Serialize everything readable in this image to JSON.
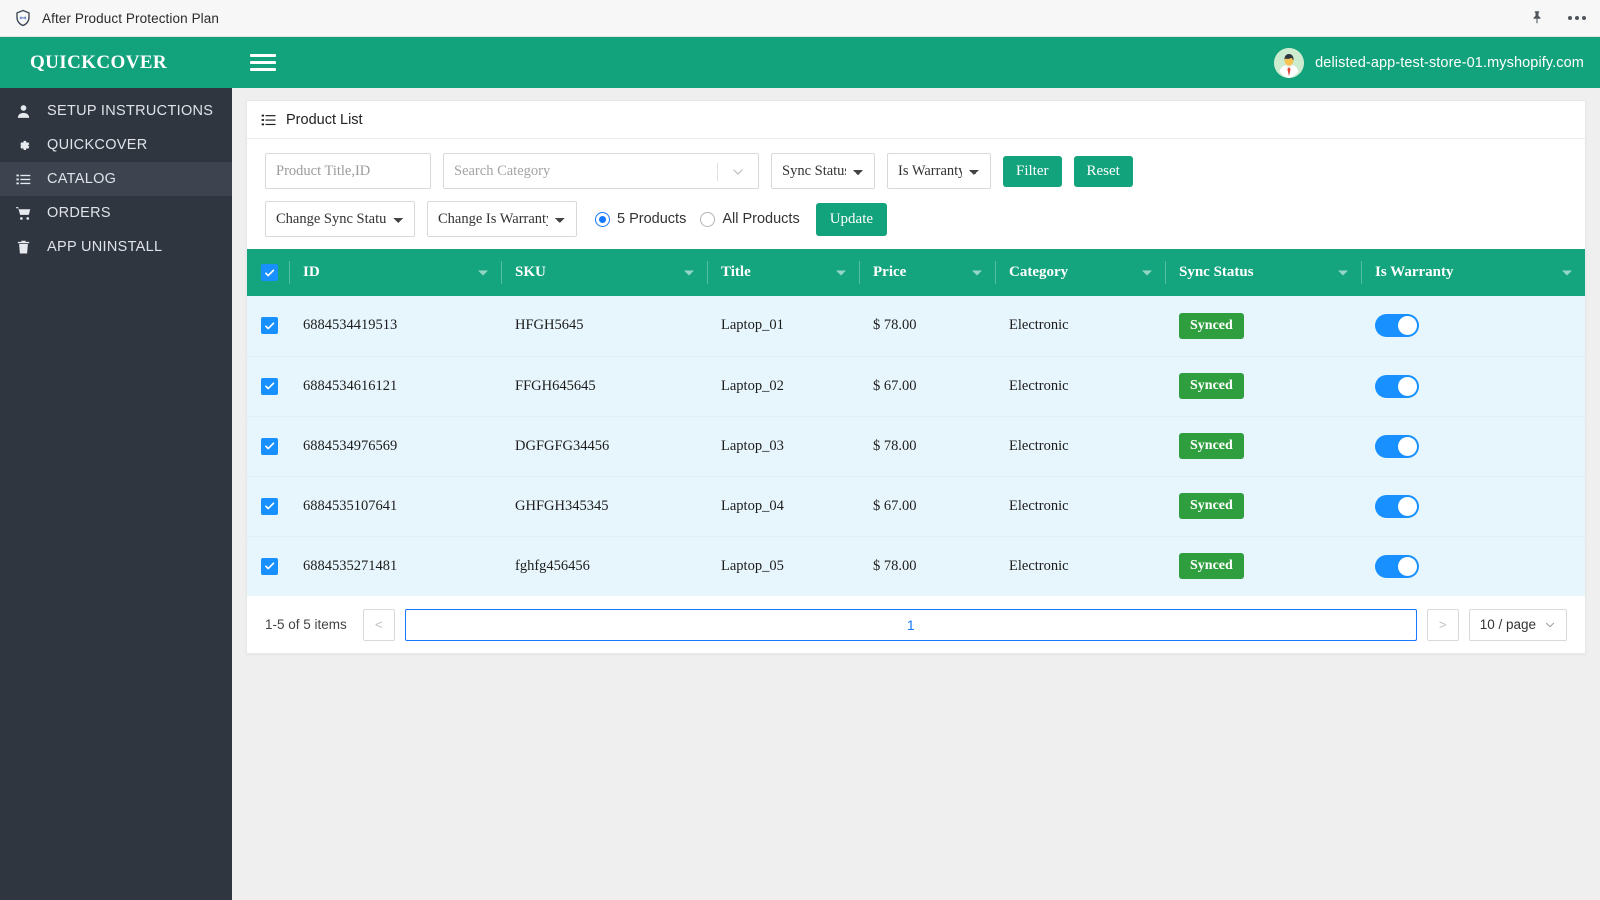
{
  "browser": {
    "title": "After Product Protection Plan",
    "shield_icon": "shield-icon",
    "pin_icon": "pin-icon",
    "more_icon": "more-options-icon"
  },
  "sidebar": {
    "brand": "QUICKCOVER",
    "items": [
      {
        "label": "SETUP INSTRUCTIONS",
        "icon": "user-icon",
        "active": false
      },
      {
        "label": "QUICKCOVER",
        "icon": "gear-icon",
        "active": false
      },
      {
        "label": "CATALOG",
        "icon": "list-icon",
        "active": true
      },
      {
        "label": "ORDERS",
        "icon": "cart-icon",
        "active": false
      },
      {
        "label": "APP UNINSTALL",
        "icon": "trash-icon",
        "active": false
      }
    ]
  },
  "topbar": {
    "menu_icon": "hamburger-icon",
    "store_name": "delisted-app-test-store-01.myshopify.com",
    "avatar_icon": "avatar-icon"
  },
  "panel": {
    "title": "Product List",
    "title_icon": "list-icon"
  },
  "filters": {
    "product_title_placeholder": "Product Title,ID",
    "product_title_value": "",
    "category_placeholder": "Search Category",
    "category_value": "",
    "sync_status_selected": "Sync Status",
    "sync_status_options": [
      "Sync Status"
    ],
    "is_warranty_selected": "Is Warranty",
    "is_warranty_options": [
      "Is Warranty"
    ],
    "filter_button": "Filter",
    "reset_button": "Reset",
    "change_sync_selected": "Change Sync Status",
    "change_sync_options": [
      "Change Sync Status"
    ],
    "change_warranty_selected": "Change Is Warranty",
    "change_warranty_options": [
      "Change Is Warranty"
    ],
    "radio_products_label": "5 Products",
    "radio_all_label": "All Products",
    "radio_selected": "5 Products",
    "update_button": "Update"
  },
  "table": {
    "select_all_checked": true,
    "columns": [
      {
        "label": "ID"
      },
      {
        "label": "SKU"
      },
      {
        "label": "Title"
      },
      {
        "label": "Price"
      },
      {
        "label": "Category"
      },
      {
        "label": "Sync Status"
      },
      {
        "label": "Is Warranty"
      }
    ],
    "rows": [
      {
        "checked": true,
        "id": "6884534419513",
        "sku": "HFGH5645",
        "title": "Laptop_01",
        "price": "$ 78.00",
        "category": "Electronic",
        "sync_status": "Synced",
        "is_warranty": true
      },
      {
        "checked": true,
        "id": "6884534616121",
        "sku": "FFGH645645",
        "title": "Laptop_02",
        "price": "$ 67.00",
        "category": "Electronic",
        "sync_status": "Synced",
        "is_warranty": true
      },
      {
        "checked": true,
        "id": "6884534976569",
        "sku": "DGFGFG34456",
        "title": "Laptop_03",
        "price": "$ 78.00",
        "category": "Electronic",
        "sync_status": "Synced",
        "is_warranty": true
      },
      {
        "checked": true,
        "id": "6884535107641",
        "sku": "GHFGH345345",
        "title": "Laptop_04",
        "price": "$ 67.00",
        "category": "Electronic",
        "sync_status": "Synced",
        "is_warranty": true
      },
      {
        "checked": true,
        "id": "6884535271481",
        "sku": "fghfg456456",
        "title": "Laptop_05",
        "price": "$ 78.00",
        "category": "Electronic",
        "sync_status": "Synced",
        "is_warranty": true
      }
    ]
  },
  "pagination": {
    "total_text": "1-5 of 5 items",
    "prev_label": "<",
    "next_label": ">",
    "current_page": "1",
    "page_size": "10 / page"
  },
  "colors": {
    "brand_green": "#12a27c",
    "table_header_green": "#14a47e",
    "badge_green": "#2e9e3e",
    "toggle_blue": "#1890ff",
    "sidebar_dark": "#2f3640",
    "row_blue": "#e7f6fd"
  }
}
